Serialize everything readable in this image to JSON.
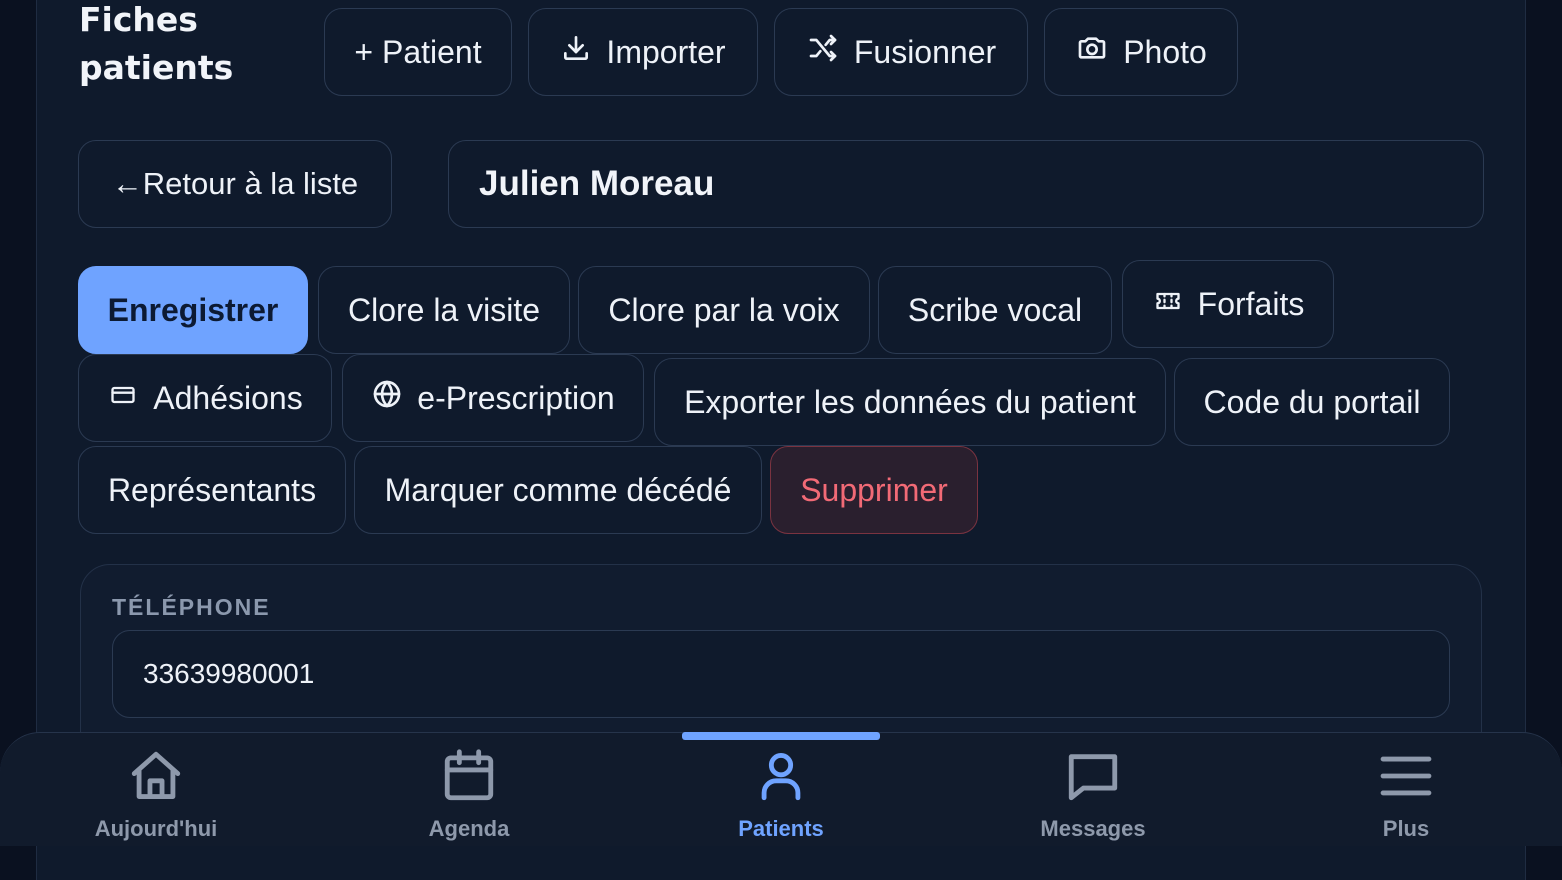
{
  "page": {
    "title": "Fiches patients"
  },
  "toolbar": {
    "add_patient": "+ Patient",
    "import": "Importer",
    "merge": "Fusionner",
    "photo": "Photo"
  },
  "back_label": "←Retour à la liste",
  "patient_name": "Julien Moreau",
  "actions": {
    "save": "Enregistrer",
    "close_visit": "Clore la visite",
    "close_voice": "Clore par la voix",
    "voice_scribe": "Scribe vocal",
    "packages": "Forfaits",
    "memberships": "Adhésions",
    "eprescription": "e-Prescription",
    "export": "Exporter les données du patient",
    "portal_code": "Code du portail",
    "representatives": "Représentants",
    "mark_deceased": "Marquer comme décédé",
    "delete": "Supprimer"
  },
  "phone": {
    "label": "TÉLÉPHONE",
    "value": "33639980001"
  },
  "nav": {
    "today": "Aujourd'hui",
    "agenda": "Agenda",
    "patients": "Patients",
    "messages": "Messages",
    "more": "Plus"
  },
  "colors": {
    "accent": "#6fa3ff",
    "danger": "#f26a76",
    "background": "#0f1a2c"
  },
  "icons": {
    "import": "download-icon",
    "merge": "shuffle-icon",
    "photo": "camera-icon",
    "packages": "ticket-icon",
    "memberships": "credit-card-icon",
    "eprescription": "globe-icon"
  }
}
